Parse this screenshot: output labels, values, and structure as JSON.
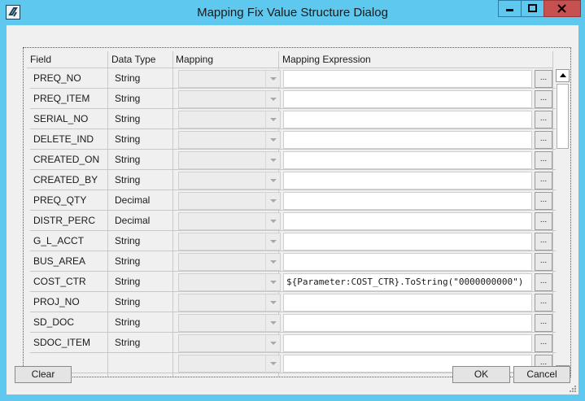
{
  "window": {
    "title": "Mapping Fix Value Structure Dialog"
  },
  "grid": {
    "headers": {
      "field": "Field",
      "data_type": "Data Type",
      "mapping": "Mapping",
      "expression": "Mapping Expression"
    },
    "ellipsis": "...",
    "rows": [
      {
        "field": "PREQ_NO",
        "type": "String",
        "expression": ""
      },
      {
        "field": "PREQ_ITEM",
        "type": "String",
        "expression": ""
      },
      {
        "field": "SERIAL_NO",
        "type": "String",
        "expression": ""
      },
      {
        "field": "DELETE_IND",
        "type": "String",
        "expression": ""
      },
      {
        "field": "CREATED_ON",
        "type": "String",
        "expression": ""
      },
      {
        "field": "CREATED_BY",
        "type": "String",
        "expression": ""
      },
      {
        "field": "PREQ_QTY",
        "type": "Decimal",
        "expression": ""
      },
      {
        "field": "DISTR_PERC",
        "type": "Decimal",
        "expression": ""
      },
      {
        "field": "G_L_ACCT",
        "type": "String",
        "expression": ""
      },
      {
        "field": "BUS_AREA",
        "type": "String",
        "expression": ""
      },
      {
        "field": "COST_CTR",
        "type": "String",
        "expression": "${Parameter:COST_CTR}.ToString(\"0000000000\")"
      },
      {
        "field": "PROJ_NO",
        "type": "String",
        "expression": ""
      },
      {
        "field": "SD_DOC",
        "type": "String",
        "expression": ""
      },
      {
        "field": "SDOC_ITEM",
        "type": "String",
        "expression": ""
      },
      {
        "field": "",
        "type": "",
        "expression": ""
      }
    ]
  },
  "buttons": {
    "clear": "Clear",
    "ok": "OK",
    "cancel": "Cancel"
  }
}
